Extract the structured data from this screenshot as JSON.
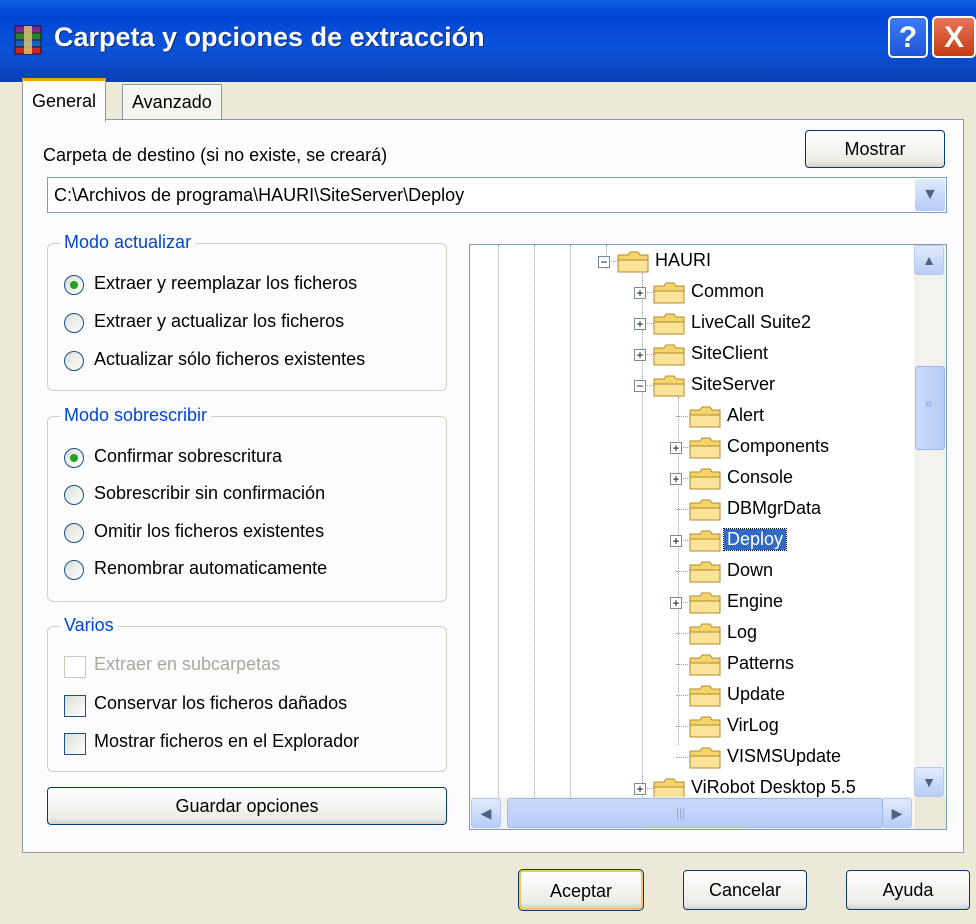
{
  "window": {
    "title": "Carpeta y opciones de extracción",
    "help_glyph": "?",
    "close_glyph": "X",
    "title_bar_color": "#0046d5"
  },
  "tabs": [
    {
      "label": "General",
      "active": true
    },
    {
      "label": "Avanzado",
      "active": false
    }
  ],
  "destination": {
    "label": "Carpeta de destino (si no existe, se creará)",
    "show_button": "Mostrar",
    "path": "C:\\Archivos de programa\\HAURI\\SiteServer\\Deploy"
  },
  "update_mode": {
    "title": "Modo actualizar",
    "options": [
      {
        "label": "Extraer y reemplazar los ficheros",
        "selected": true
      },
      {
        "label": "Extraer y actualizar los ficheros",
        "selected": false
      },
      {
        "label": "Actualizar sólo ficheros existentes",
        "selected": false
      }
    ]
  },
  "overwrite_mode": {
    "title": "Modo sobrescribir",
    "options": [
      {
        "label": "Confirmar sobrescritura",
        "selected": true
      },
      {
        "label": "Sobrescribir sin confirmación",
        "selected": false
      },
      {
        "label": "Omitir los ficheros existentes",
        "selected": false
      },
      {
        "label": "Renombrar automaticamente",
        "selected": false
      }
    ]
  },
  "misc": {
    "title": "Varios",
    "options": [
      {
        "label": "Extraer en subcarpetas",
        "checked": false,
        "enabled": false
      },
      {
        "label": "Conservar los ficheros dañados",
        "checked": false,
        "enabled": true
      },
      {
        "label": "Mostrar ficheros en el Explorador",
        "checked": false,
        "enabled": true
      }
    ]
  },
  "save_options_button": "Guardar opciones",
  "folder_tree": {
    "selected": "Deploy",
    "nodes": [
      {
        "label": "HAURI",
        "expander": "−"
      },
      {
        "label": "Common",
        "expander": "+"
      },
      {
        "label": "LiveCall Suite2",
        "expander": "+"
      },
      {
        "label": "SiteClient",
        "expander": "+"
      },
      {
        "label": "SiteServer",
        "expander": "−"
      },
      {
        "label": "Alert",
        "expander": ""
      },
      {
        "label": "Components",
        "expander": "+"
      },
      {
        "label": "Console",
        "expander": "+"
      },
      {
        "label": "DBMgrData",
        "expander": ""
      },
      {
        "label": "Deploy",
        "expander": "+"
      },
      {
        "label": "Down",
        "expander": ""
      },
      {
        "label": "Engine",
        "expander": "+"
      },
      {
        "label": "Log",
        "expander": ""
      },
      {
        "label": "Patterns",
        "expander": ""
      },
      {
        "label": "Update",
        "expander": ""
      },
      {
        "label": "VirLog",
        "expander": ""
      },
      {
        "label": "VISMSUpdate",
        "expander": ""
      },
      {
        "label": "ViRobot Desktop 5.5",
        "expander": "+"
      }
    ]
  },
  "footer": {
    "ok": "Aceptar",
    "cancel": "Cancelar",
    "help": "Ayuda"
  },
  "icons": {
    "app": "winrar-books-icon",
    "folder": "folder-icon",
    "scroll_up": "▲",
    "scroll_down": "▼",
    "scroll_left": "◀",
    "scroll_right": "▶",
    "combo_arrow": "▼",
    "grip_v": "≡",
    "grip_h": "|||"
  }
}
